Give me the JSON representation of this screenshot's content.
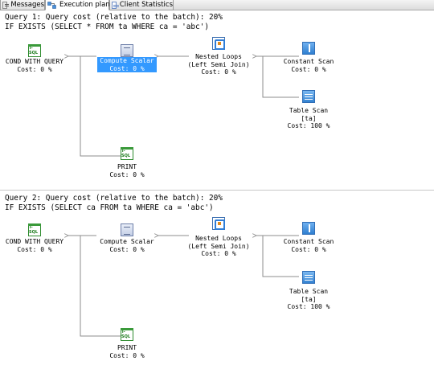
{
  "tabs": [
    {
      "label": "Messages",
      "icon": "messages-icon",
      "active": false
    },
    {
      "label": "Execution plan",
      "icon": "execution-plan-icon",
      "active": true
    },
    {
      "label": "Client Statistics",
      "icon": "client-statistics-icon",
      "active": false
    }
  ],
  "queries": [
    {
      "header": "Query 1: Query cost (relative to the batch): 20%",
      "sql": "IF EXISTS (SELECT * FROM ta WHERE ca = 'abc')",
      "nodes": {
        "cond": {
          "name": "COND WITH QUERY",
          "cost": "Cost: 0 %",
          "icon_label": "T-SQL"
        },
        "compute": {
          "name": "Compute Scalar",
          "cost": "Cost: 0 %",
          "selected": true
        },
        "loops": {
          "name": "Nested Loops",
          "sub": "(Left Semi Join)",
          "cost": "Cost: 0 %"
        },
        "const": {
          "name": "Constant Scan",
          "cost": "Cost: 0 %"
        },
        "table": {
          "name": "Table Scan",
          "sub": "[ta]",
          "cost": "Cost: 100 %"
        },
        "print": {
          "name": "PRINT",
          "cost": "Cost: 0 %",
          "icon_label": "T-SQL"
        }
      }
    },
    {
      "header": "Query 2: Query cost (relative to the batch): 20%",
      "sql": "IF EXISTS (SELECT ca FROM ta WHERE ca = 'abc')",
      "nodes": {
        "cond": {
          "name": "COND WITH QUERY",
          "cost": "Cost: 0 %",
          "icon_label": "T-SQL"
        },
        "compute": {
          "name": "Compute Scalar",
          "cost": "Cost: 0 %",
          "selected": false
        },
        "loops": {
          "name": "Nested Loops",
          "sub": "(Left Semi Join)",
          "cost": "Cost: 0 %"
        },
        "const": {
          "name": "Constant Scan",
          "cost": "Cost: 0 %"
        },
        "table": {
          "name": "Table Scan",
          "sub": "[ta]",
          "cost": "Cost: 100 %"
        },
        "print": {
          "name": "PRINT",
          "cost": "Cost: 0 %",
          "icon_label": "T-SQL"
        }
      }
    }
  ],
  "colors": {
    "selection": "#3399ff",
    "edge": "#8c8c8c"
  }
}
